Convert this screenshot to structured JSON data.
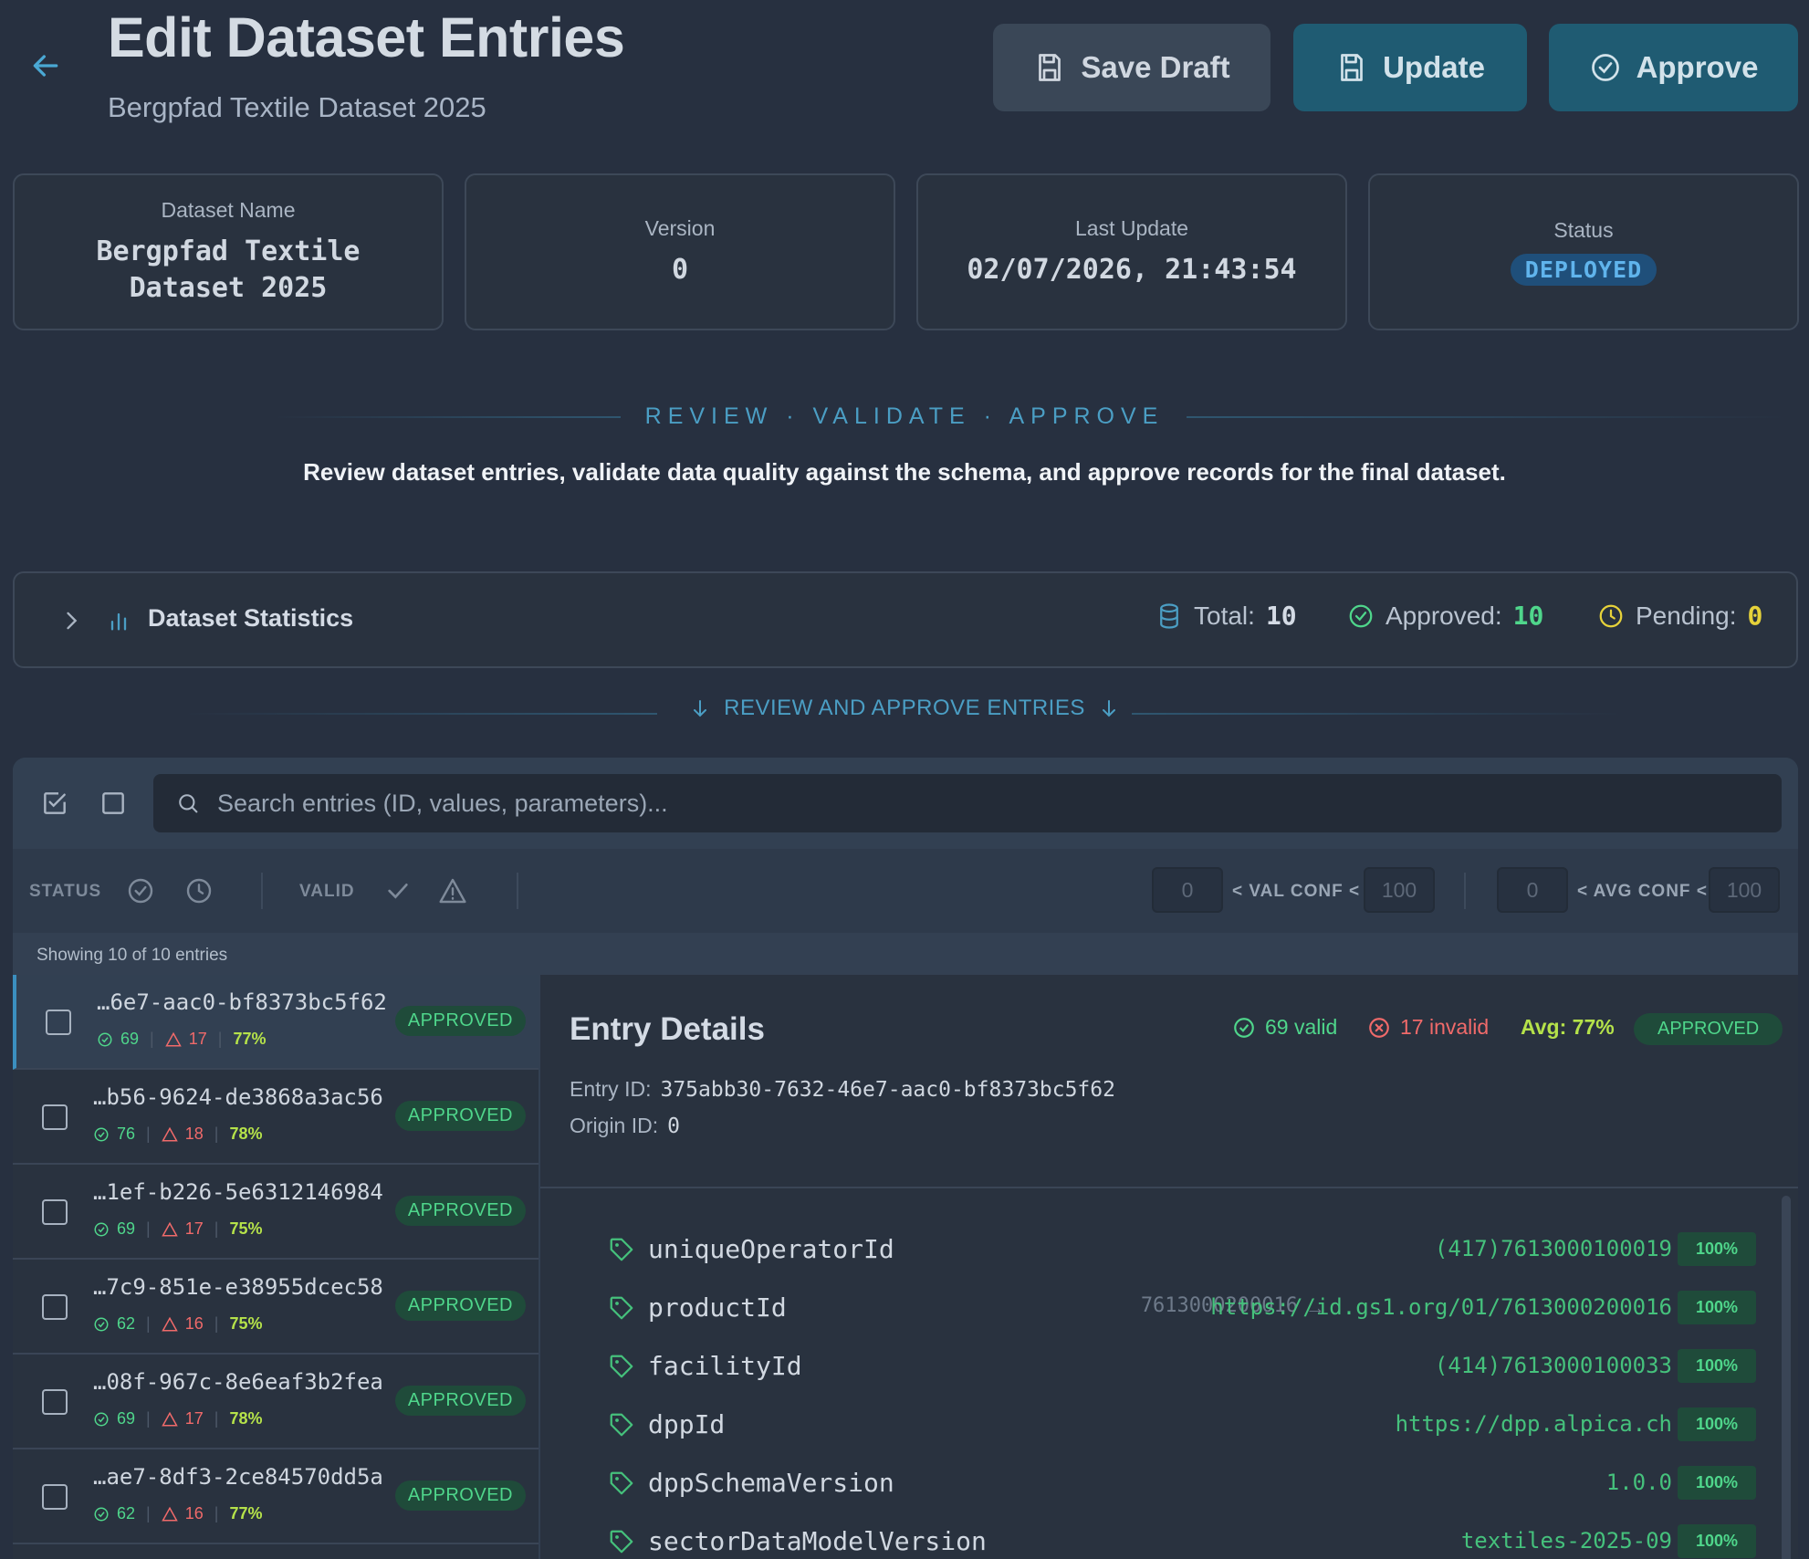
{
  "header": {
    "title": "Edit Dataset Entries",
    "subtitle": "Bergpfad Textile Dataset 2025",
    "buttons": {
      "save_draft": "Save Draft",
      "update": "Update",
      "approve": "Approve"
    }
  },
  "info_cards": {
    "name": {
      "label": "Dataset Name",
      "value": "Bergpfad Textile Dataset 2025"
    },
    "version": {
      "label": "Version",
      "value": "0"
    },
    "last_update": {
      "label": "Last Update",
      "value": "02/07/2026, 21:43:54"
    },
    "status": {
      "label": "Status",
      "value": "DEPLOYED"
    }
  },
  "section": {
    "kicker": "REVIEW · VALIDATE · APPROVE",
    "description": "Review dataset entries, validate data quality against the schema, and approve records for the final dataset."
  },
  "stats": {
    "title": "Dataset Statistics",
    "total_label": "Total:",
    "total": "10",
    "approved_label": "Approved:",
    "approved": "10",
    "pending_label": "Pending:",
    "pending": "0"
  },
  "review_bar": "REVIEW AND APPROVE ENTRIES",
  "search": {
    "placeholder": "Search entries (ID, values, parameters)..."
  },
  "filters": {
    "status_label": "STATUS",
    "valid_label": "VALID",
    "val_conf_label": "< VAL CONF <",
    "avg_conf_label": "< AVG CONF <",
    "val_min": "0",
    "val_max": "100",
    "avg_min": "0",
    "avg_max": "100"
  },
  "showing": "Showing 10 of 10 entries",
  "entries": [
    {
      "id": "…6e7-aac0-bf8373bc5f62",
      "valid": "69",
      "invalid": "17",
      "avg": "77%",
      "status": "APPROVED"
    },
    {
      "id": "…b56-9624-de3868a3ac56",
      "valid": "76",
      "invalid": "18",
      "avg": "78%",
      "status": "APPROVED"
    },
    {
      "id": "…1ef-b226-5e6312146984",
      "valid": "69",
      "invalid": "17",
      "avg": "75%",
      "status": "APPROVED"
    },
    {
      "id": "…7c9-851e-e38955dcec58",
      "valid": "62",
      "invalid": "16",
      "avg": "75%",
      "status": "APPROVED"
    },
    {
      "id": "…08f-967c-8e6eaf3b2fea",
      "valid": "69",
      "invalid": "17",
      "avg": "78%",
      "status": "APPROVED"
    },
    {
      "id": "…ae7-8df3-2ce84570dd5a",
      "valid": "62",
      "invalid": "16",
      "avg": "77%",
      "status": "APPROVED"
    }
  ],
  "detail": {
    "title": "Entry Details",
    "valid": "69 valid",
    "invalid": "17 invalid",
    "avg": "Avg: 77%",
    "status": "APPROVED",
    "entry_id_label": "Entry ID:",
    "entry_id": "375abb30-7632-46e7-aac0-bf8373bc5f62",
    "origin_id_label": "Origin ID:",
    "origin_id": "0",
    "fields": [
      {
        "name": "uniqueOperatorId",
        "original": "",
        "value": "(417)7613000100019",
        "confidence": "100%"
      },
      {
        "name": "productId",
        "original": "7613000200016",
        "value": "https://id.gs1.org/01/7613000200016",
        "confidence": "100%"
      },
      {
        "name": "facilityId",
        "original": "",
        "value": "(414)7613000100033",
        "confidence": "100%"
      },
      {
        "name": "dppId",
        "original": "",
        "value": "https://dpp.alpica.ch",
        "confidence": "100%"
      },
      {
        "name": "dppSchemaVersion",
        "original": "",
        "value": "1.0.0",
        "confidence": "100%"
      },
      {
        "name": "sectorDataModelVersion",
        "original": "",
        "value": "textiles-2025-09",
        "confidence": "100%"
      }
    ]
  },
  "colors": {
    "background": "#273040",
    "accent": "#4b9ec4",
    "approved": "#4fd68b",
    "invalid": "#f06a6a",
    "avg": "#b5e24a",
    "pending": "#e6d23a"
  }
}
